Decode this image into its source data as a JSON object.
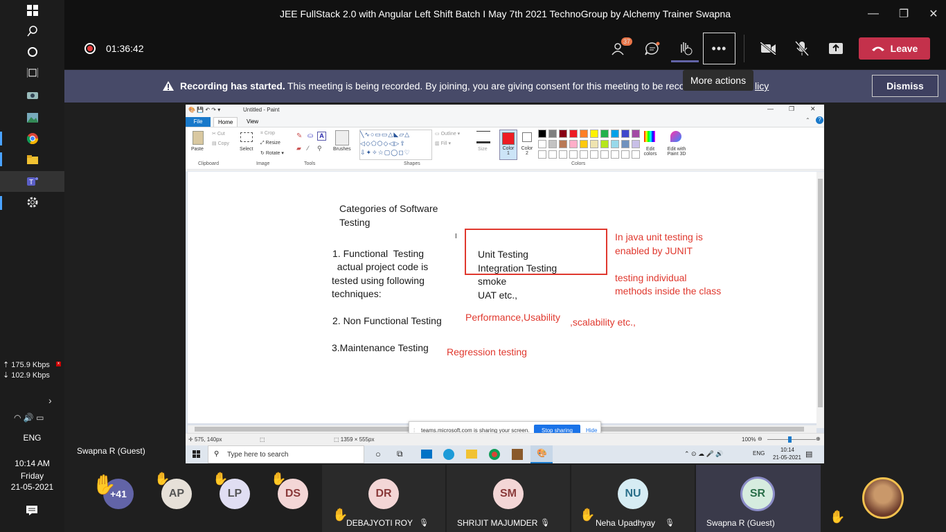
{
  "window": {
    "title": "JEE FullStack 2.0 with Angular Left Shift Batch I May 7th 2021 TechnoGroup by Alchemy Trainer Swapna"
  },
  "meeting": {
    "timer": "01:36:42",
    "participants_badge": "37",
    "more_actions_tooltip": "More actions",
    "leave_label": "Leave"
  },
  "banner": {
    "title": "Recording has started.",
    "message": "This meeting is being recorded. By joining, you are giving consent for this meeting to be reco",
    "link_tail": "licy",
    "dismiss_label": "Dismiss"
  },
  "os": {
    "upload_speed": "175.9 Kbps",
    "download_speed": "102.9 Kbps",
    "language": "ENG",
    "time": "10:14 AM",
    "day": "Friday",
    "date": "21-05-2021"
  },
  "presenter_label": "Swapna R (Guest)",
  "paint": {
    "title": "Untitled - Paint",
    "tabs": [
      "File",
      "Home",
      "View"
    ],
    "tools": {
      "cut": "Cut",
      "copy": "Copy",
      "paste": "Paste",
      "select": "Select",
      "crop": "Crop",
      "resize": "Resize",
      "rotate": "Rotate ▾",
      "brushes": "Brushes",
      "outline": "Outline ▾",
      "fill": "Fill ▾",
      "size": "Size",
      "color1": "Color 1",
      "color2": "Color 2",
      "edit_colors": "Edit colors",
      "paint3d": "Edit with Paint 3D"
    },
    "groups": [
      "Clipboard",
      "Image",
      "Tools",
      "Shapes",
      "Colors"
    ],
    "canvas": {
      "heading1": "Categories of Software",
      "heading2": "Testing",
      "item1": "1. Functional  Testing",
      "item1b": "  actual project code is",
      "item1c": "tested using following",
      "item1d": "techniques:",
      "box1": "Unit Testing",
      "box2": "Integration Testing",
      "smoke": "smoke",
      "uat": "UAT etc.,",
      "item2": "2. Non Functional Testing",
      "item3": "3.Maintenance Testing",
      "note1": "In java unit testing is",
      "note2": "enabled by JUNIT",
      "note3": "testing individual",
      "note4": "methods inside the class",
      "nf_ex1": "Performance,Usability",
      "nf_ex2": ",scalability etc.,",
      "regression": "Regression testing"
    },
    "share_bar": {
      "message": "teams.microsoft.com is sharing your screen.",
      "stop": "Stop sharing",
      "hide": "Hide"
    },
    "status": {
      "cursor": "575, 140px",
      "size": "1359 × 555px",
      "zoom": "100%"
    },
    "taskbar": {
      "search_placeholder": "Type here to search",
      "lang": "ENG",
      "time": "10:14",
      "date": "21-05-2021"
    }
  },
  "participants": {
    "more_count": "+41",
    "raised": [
      {
        "initials": "AP",
        "color": "#e6e0d8"
      },
      {
        "initials": "LP",
        "color": "#e0def2"
      },
      {
        "initials": "DS",
        "color": "#f3d6d6"
      }
    ],
    "tiles": [
      {
        "initials": "DR",
        "name": "DEBAJYOTI ROY",
        "color": "#f3d6d6"
      },
      {
        "initials": "SM",
        "name": "SHRIJIT MAJUMDER",
        "color": "#f3d6d6"
      },
      {
        "initials": "NU",
        "name": "Neha Upadhyay",
        "color": "#d6ecf3"
      },
      {
        "initials": "SR",
        "name": "Swapna R (Guest)",
        "color": "#d6ecdf"
      }
    ]
  },
  "colors": {
    "leave": "#c4314b",
    "banner": "#474a68",
    "accent": "#6264a7",
    "red_annot": "#e0382e"
  }
}
